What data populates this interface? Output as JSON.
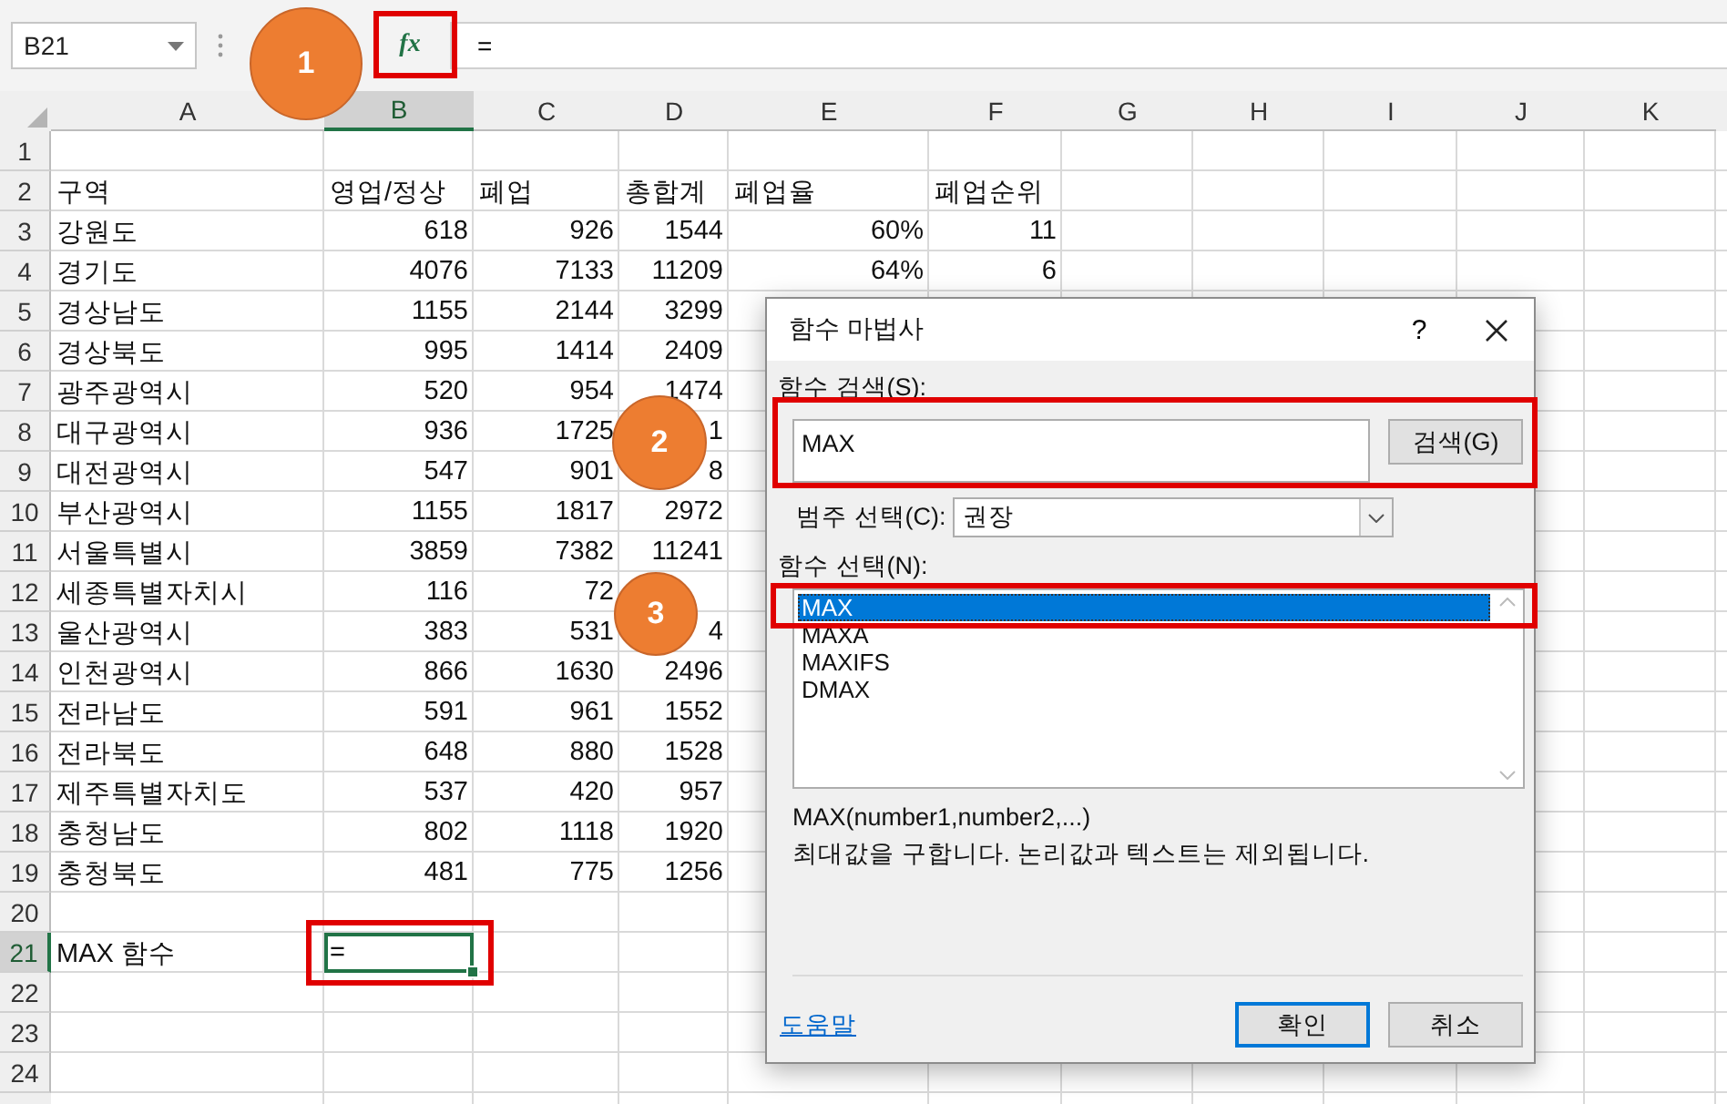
{
  "name_box": {
    "value": "B21"
  },
  "formula_bar": {
    "function_button": "fx",
    "formula": "="
  },
  "columns": [
    {
      "label": "A",
      "selected": false
    },
    {
      "label": "B",
      "selected": true
    },
    {
      "label": "C",
      "selected": false
    },
    {
      "label": "D",
      "selected": false
    },
    {
      "label": "E",
      "selected": false
    },
    {
      "label": "F",
      "selected": false
    },
    {
      "label": "G",
      "selected": false
    },
    {
      "label": "H",
      "selected": false
    },
    {
      "label": "I",
      "selected": false
    },
    {
      "label": "J",
      "selected": false
    },
    {
      "label": "K",
      "selected": false
    }
  ],
  "rows": [
    {
      "number": "1",
      "kind": "blank",
      "selected": false
    },
    {
      "number": "2",
      "kind": "header",
      "selected": false,
      "cells": [
        "구역",
        "영업/정상",
        "폐업",
        "총합계",
        "폐업율",
        "폐업순위"
      ]
    },
    {
      "number": "3",
      "kind": "data",
      "selected": false,
      "cells": [
        "강원도",
        "618",
        "926",
        "1544",
        "60%",
        "11"
      ]
    },
    {
      "number": "4",
      "kind": "data",
      "selected": false,
      "cells": [
        "경기도",
        "4076",
        "7133",
        "11209",
        "64%",
        "6"
      ]
    },
    {
      "number": "5",
      "kind": "data",
      "selected": false,
      "cells": [
        "경상남도",
        "1155",
        "2144",
        "3299"
      ]
    },
    {
      "number": "6",
      "kind": "data",
      "selected": false,
      "cells": [
        "경상북도",
        "995",
        "1414",
        "2409"
      ]
    },
    {
      "number": "7",
      "kind": "data",
      "selected": false,
      "cells": [
        "광주광역시",
        "520",
        "954",
        "1474"
      ]
    },
    {
      "number": "8",
      "kind": "data",
      "selected": false,
      "cells": [
        "대구광역시",
        "936",
        "1725",
        "1"
      ]
    },
    {
      "number": "9",
      "kind": "data",
      "selected": false,
      "cells": [
        "대전광역시",
        "547",
        "901",
        "8"
      ]
    },
    {
      "number": "10",
      "kind": "data",
      "selected": false,
      "cells": [
        "부산광역시",
        "1155",
        "1817",
        "2972"
      ]
    },
    {
      "number": "11",
      "kind": "data",
      "selected": false,
      "cells": [
        "서울특별시",
        "3859",
        "7382",
        "11241"
      ]
    },
    {
      "number": "12",
      "kind": "data",
      "selected": false,
      "cells": [
        "세종특별자치시",
        "116",
        "72"
      ]
    },
    {
      "number": "13",
      "kind": "data",
      "selected": false,
      "cells": [
        "울산광역시",
        "383",
        "531",
        "4"
      ]
    },
    {
      "number": "14",
      "kind": "data",
      "selected": false,
      "cells": [
        "인천광역시",
        "866",
        "1630",
        "2496"
      ]
    },
    {
      "number": "15",
      "kind": "data",
      "selected": false,
      "cells": [
        "전라남도",
        "591",
        "961",
        "1552"
      ]
    },
    {
      "number": "16",
      "kind": "data",
      "selected": false,
      "cells": [
        "전라북도",
        "648",
        "880",
        "1528"
      ]
    },
    {
      "number": "17",
      "kind": "data",
      "selected": false,
      "cells": [
        "제주특별자치도",
        "537",
        "420",
        "957"
      ]
    },
    {
      "number": "18",
      "kind": "data",
      "selected": false,
      "cells": [
        "충청남도",
        "802",
        "1118",
        "1920"
      ]
    },
    {
      "number": "19",
      "kind": "data",
      "selected": false,
      "cells": [
        "충청북도",
        "481",
        "775",
        "1256"
      ]
    },
    {
      "number": "20",
      "kind": "blank",
      "selected": false
    },
    {
      "number": "21",
      "kind": "input",
      "selected": true,
      "cells": [
        "MAX 함수",
        "="
      ]
    },
    {
      "number": "22",
      "kind": "blank",
      "selected": false
    },
    {
      "number": "23",
      "kind": "blank",
      "selected": false
    },
    {
      "number": "24",
      "kind": "blank",
      "selected": false
    }
  ],
  "callouts": [
    {
      "label": "1"
    },
    {
      "label": "2"
    },
    {
      "label": "3"
    }
  ],
  "dialog": {
    "title": "함수 마법사",
    "help_button": "?",
    "search_label": "함수 검색(S):",
    "search_value": "MAX",
    "search_button": "검색(G)",
    "category_label": "범주 선택(C):",
    "category_value": "권장",
    "list_label": "함수 선택(N):",
    "functions": [
      {
        "name": "MAX",
        "selected": true
      },
      {
        "name": "MAXA",
        "selected": false
      },
      {
        "name": "MAXIFS",
        "selected": false
      },
      {
        "name": "DMAX",
        "selected": false
      }
    ],
    "syntax": "MAX(number1,number2,...)",
    "description": "최대값을 구합니다. 논리값과 텍스트는 제외됩니다.",
    "help_link": "도움말",
    "buttons": [
      {
        "label": "확인",
        "default": true
      },
      {
        "label": "취소",
        "default": false
      }
    ]
  }
}
